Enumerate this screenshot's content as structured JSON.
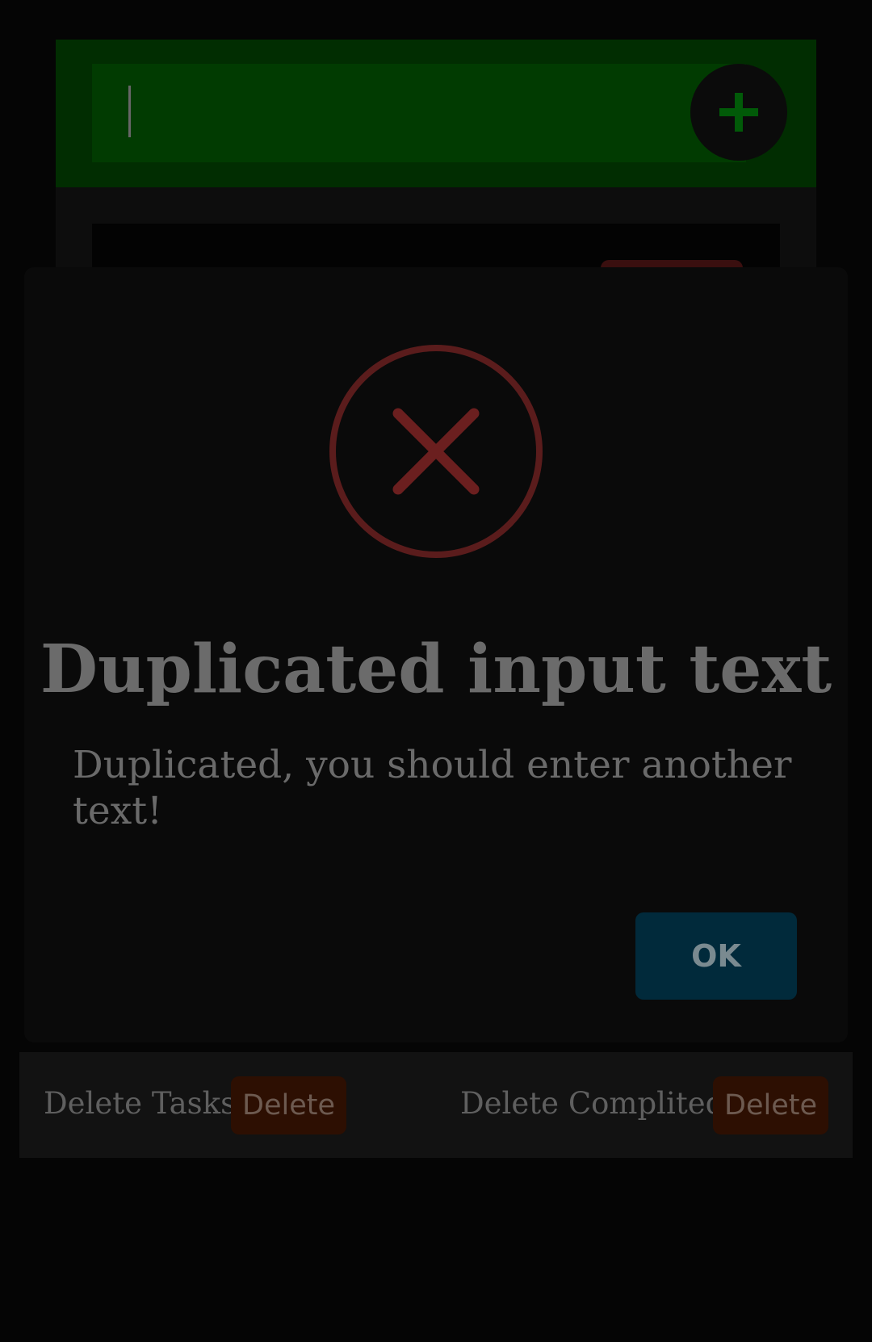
{
  "input": {
    "value": "",
    "placeholder": ""
  },
  "add_button": {
    "icon": "plus-icon",
    "color": "#01700a"
  },
  "dialog": {
    "icon": "error-x-icon",
    "icon_color": "#6b2020",
    "title": "Duplicated input text",
    "message": "Duplicated, you should enter another text!",
    "ok_label": "OK"
  },
  "footer": {
    "delete_tasks_label": "Delete Tasks:",
    "delete_tasks_button": "Delete",
    "delete_completed_label": "Delete Complited:",
    "delete_completed_button": "Delete"
  },
  "colors": {
    "header_bg": "#012d01",
    "input_bg": "#013b01",
    "ok_button_bg": "#012a3b",
    "delete_button_bg": "#2d0f02"
  }
}
